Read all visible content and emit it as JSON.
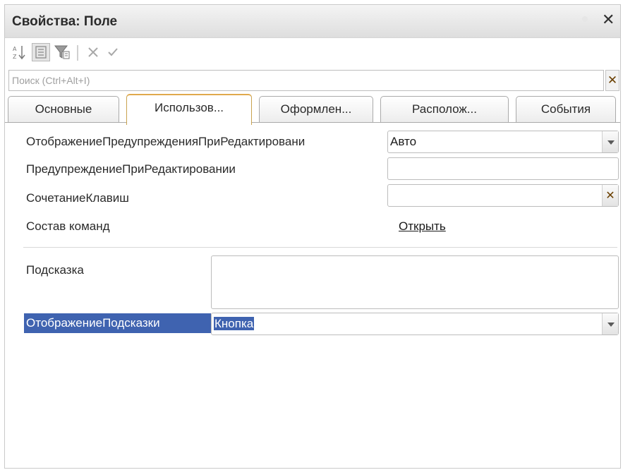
{
  "window": {
    "title": "Свойства: Поле"
  },
  "toolbar": {
    "buttons": [
      {
        "icon": "sort-alpha-icon"
      },
      {
        "icon": "categories-icon"
      },
      {
        "icon": "filter-icon"
      },
      {
        "icon": "cancel-icon"
      },
      {
        "icon": "check-icon"
      }
    ]
  },
  "search": {
    "placeholder": "Поиск (Ctrl+Alt+I)"
  },
  "tabs": [
    {
      "label": "Основные"
    },
    {
      "label": "Использов..."
    },
    {
      "label": "Оформлен..."
    },
    {
      "label": "Располож..."
    },
    {
      "label": "События"
    }
  ],
  "properties": {
    "warning_display": {
      "label": "ОтображениеПредупрежденияПриРедактировани",
      "value": "Авто"
    },
    "warning_text": {
      "label": "ПредупреждениеПриРедактировании",
      "value": ""
    },
    "shortcut": {
      "label": "СочетаниеКлавиш",
      "value": ""
    },
    "commands": {
      "label": "Состав команд",
      "link": "Открыть"
    },
    "tooltip": {
      "label": "Подсказка",
      "value": ""
    },
    "tooltip_display": {
      "label": "ОтображениеПодсказки",
      "value": "Кнопка"
    }
  },
  "colors": {
    "selection": "#3f63b0",
    "active_tab_accent": "#e0a94d"
  }
}
